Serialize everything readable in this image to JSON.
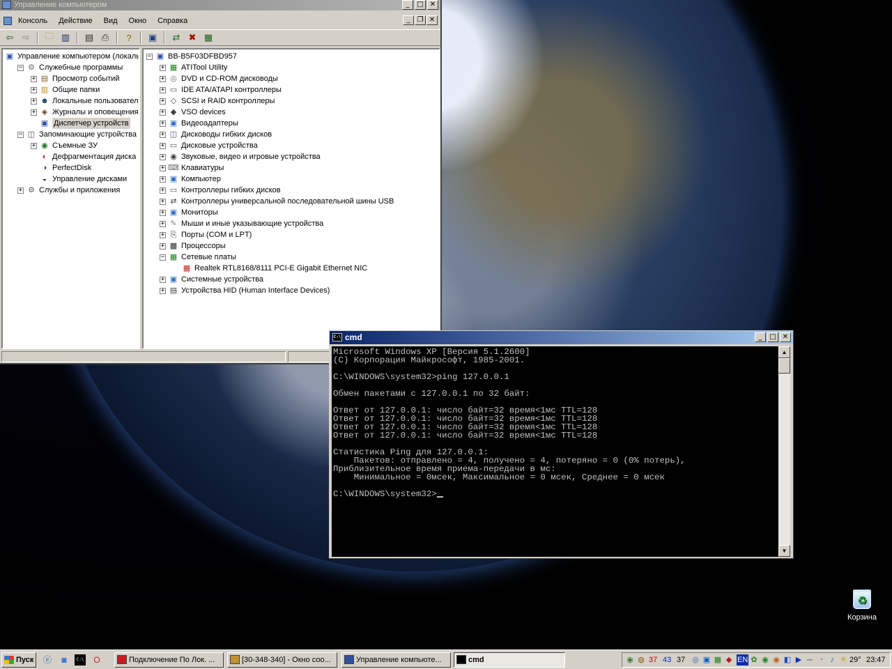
{
  "desktop": {
    "recycle_bin_label": "Корзина"
  },
  "mmc": {
    "title": "Управление компьютером",
    "menu": [
      "Консоль",
      "Действие",
      "Вид",
      "Окно",
      "Справка"
    ],
    "left_tree": [
      {
        "label": "Управление компьютером (локаль",
        "icon": "computer-management-icon"
      },
      {
        "label": "Служебные программы",
        "icon": "tools-icon"
      },
      {
        "label": "Просмотр событий",
        "icon": "event-viewer-icon"
      },
      {
        "label": "Общие папки",
        "icon": "shared-folders-icon"
      },
      {
        "label": "Локальные пользователи и",
        "icon": "users-icon"
      },
      {
        "label": "Журналы и оповещения пр",
        "icon": "performance-logs-icon"
      },
      {
        "label": "Диспетчер устройств",
        "icon": "device-manager-icon"
      },
      {
        "label": "Запоминающие устройства",
        "icon": "storage-icon"
      },
      {
        "label": "Съемные ЗУ",
        "icon": "removable-storage-icon"
      },
      {
        "label": "Дефрагментация диска",
        "icon": "defrag-icon"
      },
      {
        "label": "PerfectDisk",
        "icon": "perfectdisk-icon"
      },
      {
        "label": "Управление дисками",
        "icon": "disk-management-icon"
      },
      {
        "label": "Службы и приложения",
        "icon": "services-icon"
      }
    ],
    "device_tree": {
      "root": "BB-B5F03DFBD957",
      "items": [
        "ATITool Utility",
        "DVD и CD-ROM дисководы",
        "IDE ATA/ATAPI контроллеры",
        "SCSI и RAID контроллеры",
        "VSO devices",
        "Видеоадаптеры",
        "Дисководы гибких дисков",
        "Дисковые устройства",
        "Звуковые, видео и игровые устройства",
        "Клавиатуры",
        "Компьютер",
        "Контроллеры гибких дисков",
        "Контроллеры универсальной последовательной шины USB",
        "Мониторы",
        "Мыши и иные указывающие устройства",
        "Порты (COM и LPT)",
        "Процессоры",
        "Сетевые платы",
        "Системные устройства",
        "Устройства HID (Human Interface Devices)"
      ],
      "network_child": "Realtek RTL8168/8111 PCI-E Gigabit Ethernet NIC"
    }
  },
  "cmd": {
    "title": "cmd",
    "lines": [
      "Microsoft Windows XP [Версия 5.1.2600]",
      "(С) Корпорация Майкрософт, 1985-2001.",
      "",
      "C:\\WINDOWS\\system32>ping 127.0.0.1",
      "",
      "Обмен пакетами с 127.0.0.1 по 32 байт:",
      "",
      "Ответ от 127.0.0.1: число байт=32 время<1мс TTL=128",
      "Ответ от 127.0.0.1: число байт=32 время<1мс TTL=128",
      "Ответ от 127.0.0.1: число байт=32 время<1мс TTL=128",
      "Ответ от 127.0.0.1: число байт=32 время<1мс TTL=128",
      "",
      "Статистика Ping для 127.0.0.1:",
      "    Пакетов: отправлено = 4, получено = 4, потеряно = 0 (0% потерь),",
      "Приблизительное время приема-передачи в мс:",
      "    Минимальное = 0мсек, Максимальное = 0 мсек, Среднее = 0 мсек",
      "",
      "C:\\WINDOWS\\system32>"
    ]
  },
  "taskbar": {
    "start_label": "Пуск",
    "tasks": [
      {
        "label": "Подключение По Лок. ...",
        "icon": "network-icon",
        "active": false
      },
      {
        "label": "[30-348-340] - Окно соо...",
        "icon": "chat-icon",
        "active": false
      },
      {
        "label": "Управление компьюте...",
        "icon": "computer-management-icon",
        "active": false
      },
      {
        "label": "cmd",
        "icon": "cmd-icon",
        "active": true
      }
    ],
    "tray": {
      "counter_red": "37",
      "counter_blue": "43",
      "counter_black": "37",
      "language": "EN",
      "temperature": "29°",
      "clock": "23:47"
    }
  }
}
